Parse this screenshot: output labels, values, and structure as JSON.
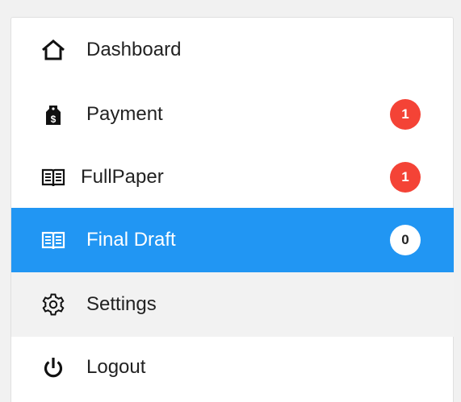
{
  "menu": {
    "items": [
      {
        "label": "Dashboard",
        "icon": "home-icon"
      },
      {
        "label": "Payment",
        "icon": "payment-tag-icon",
        "badge": "1"
      },
      {
        "label": "FullPaper",
        "icon": "open-book-icon",
        "badge": "1"
      },
      {
        "label": "Final Draft",
        "icon": "open-book-icon",
        "badge": "0"
      },
      {
        "label": "Settings",
        "icon": "gear-icon"
      },
      {
        "label": "Logout",
        "icon": "power-icon"
      }
    ]
  },
  "colors": {
    "active_background": "#2196f3",
    "badge_red": "#f44336",
    "hover_background": "#f2f2f2",
    "text": "#222222"
  }
}
